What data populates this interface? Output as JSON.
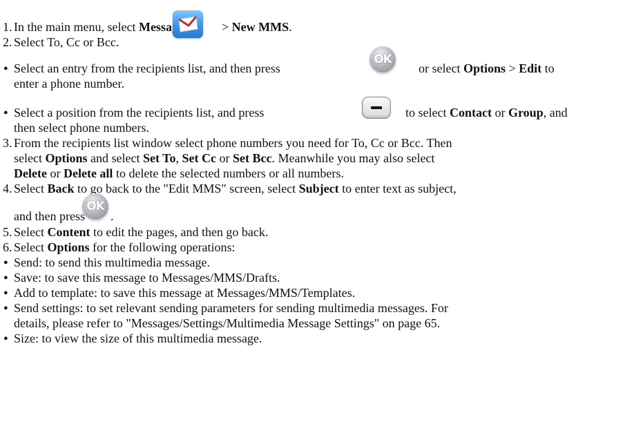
{
  "steps": {
    "s1": {
      "num": "1.",
      "pre": "In the main menu, select ",
      "b1": "Messages",
      "mid": " > ",
      "b2": "New MMS",
      "post": "."
    },
    "s2": {
      "num": "2.",
      "text": "Select To, Cc or Bcc."
    },
    "s3": {
      "num": "3.",
      "l1": "From the recipients list window select phone numbers you need for To, Cc or Bcc. Then",
      "l2": {
        "pre": "select ",
        "b1": "Options",
        "m1": " and select ",
        "b2": "Set To",
        "m2": ", ",
        "b3": "Set Cc",
        "m3": " or ",
        "b4": "Set Bcc",
        "post": ". Meanwhile you may also select"
      },
      "l3": {
        "b1": "Delete",
        "m1": " or ",
        "b2": "Delete all",
        "post": " to delete the selected numbers or all numbers."
      }
    },
    "s4": {
      "num": "4.",
      "l1": {
        "pre": "Select ",
        "b1": "Back",
        "m1": " to go back to the \"Edit MMS\" screen, select ",
        "b2": "Subject",
        "post": " to enter text as subject,"
      },
      "l2": {
        "pre": "and then press",
        "post": "."
      }
    },
    "s5": {
      "num": "5.",
      "pre": "Select ",
      "b1": "Content",
      "post": " to edit the pages, and then go back."
    },
    "s6": {
      "num": "6.",
      "pre": "Select ",
      "b1": "Options",
      "post": " for the following operations:"
    }
  },
  "bullets": {
    "b1": {
      "l1": {
        "pre": "Select an entry from the recipients list, and then press",
        "m1": "or select ",
        "b1": "Options",
        "m2": " > ",
        "b2": "Edit",
        "post": " to"
      },
      "l2": "enter a phone number."
    },
    "b2": {
      "l1": {
        "pre": "Select a position from the recipients list, and press",
        "m1": "to select ",
        "b1": "Contact",
        "m2": " or ",
        "b2": "Group",
        "post": ", and"
      },
      "l2": "then select phone numbers."
    },
    "ops": [
      {
        "text": "Send: to send this multimedia message."
      },
      {
        "text": "Save: to save this message to Messages/MMS/Drafts."
      },
      {
        "text": "Add to template: to save this message at Messages/MMS/Templates."
      },
      {
        "text": "Send settings: to set relevant sending parameters for sending multimedia messages. For",
        "text2": "details, please refer to \"Messages/Settings/Multimedia Message Settings\" on page 65."
      },
      {
        "text": "Size: to view the size of this multimedia message."
      }
    ],
    "symbol": "●"
  },
  "icons": {
    "messages": "messages-envelope-icon",
    "ok": "ok-key-icon",
    "ok_label": "OK",
    "softkey": "soft-key-icon"
  },
  "colors": {
    "icon_blue": "#3c93e6",
    "text": "#111111"
  }
}
